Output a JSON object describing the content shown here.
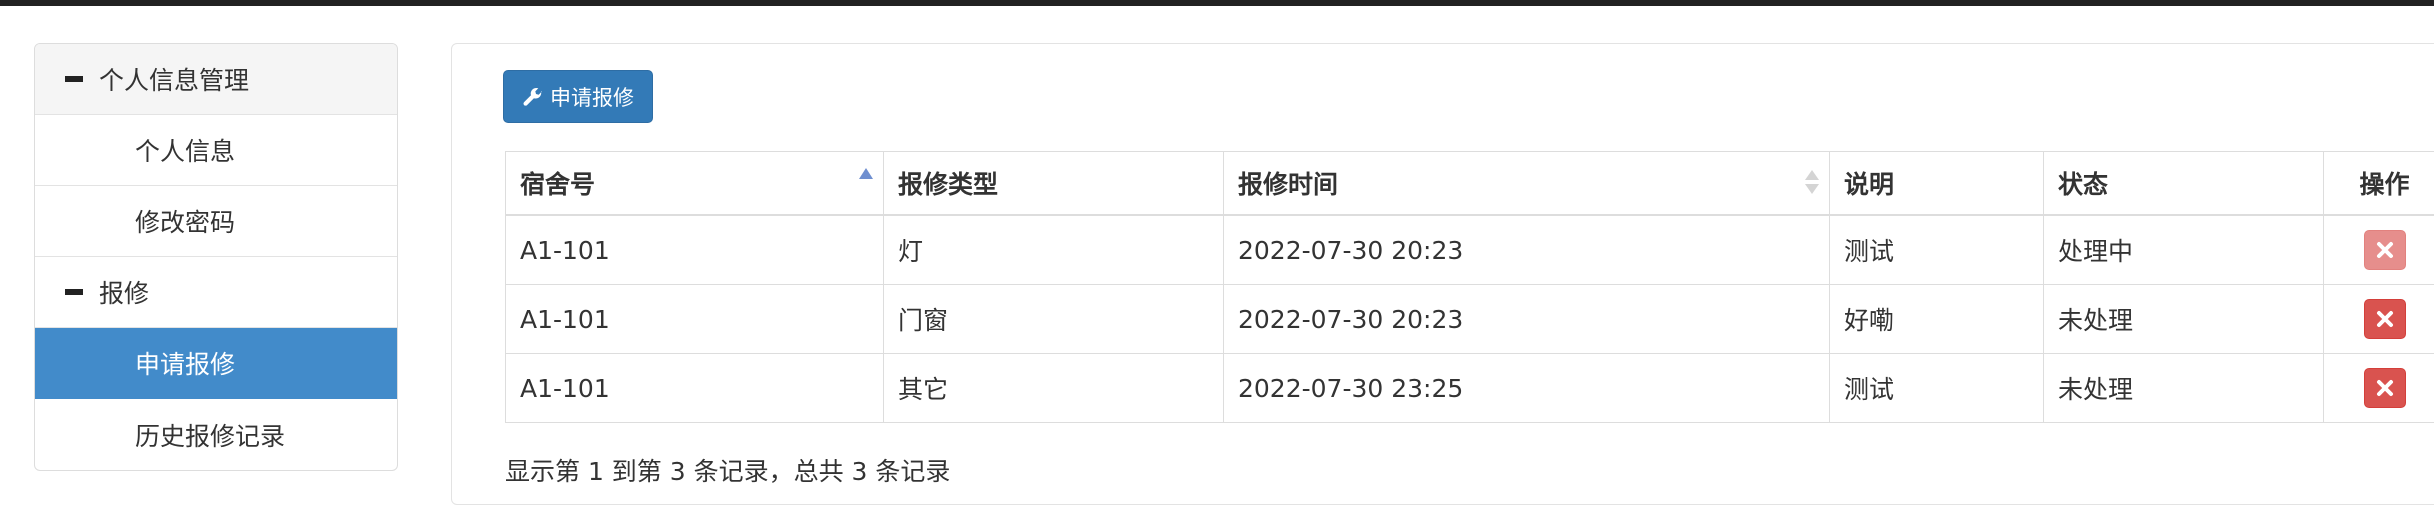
{
  "sidebar": {
    "groups": [
      {
        "label": "个人信息管理",
        "items": [
          "个人信息",
          "修改密码"
        ]
      },
      {
        "label": "报修",
        "items": [
          "申请报修",
          "历史报修记录"
        ]
      }
    ],
    "active_item": "申请报修"
  },
  "toolbar": {
    "apply_label": "申请报修",
    "apply_icon": "wrench-icon"
  },
  "table": {
    "columns": [
      "宿舍号",
      "报修类型",
      "报修时间",
      "说明",
      "状态",
      "操作"
    ],
    "sorted_column": "宿舍号",
    "sort_direction": "ascending",
    "rows": [
      {
        "room": "A1-101",
        "type": "灯",
        "time": "2022-07-30 20:23",
        "note": "测试",
        "status": "处理中",
        "action_icon": "close-icon",
        "action_enabled": false
      },
      {
        "room": "A1-101",
        "type": "门窗",
        "time": "2022-07-30 20:23",
        "note": "好嘞",
        "status": "未处理",
        "action_icon": "close-icon",
        "action_enabled": true
      },
      {
        "room": "A1-101",
        "type": "其它",
        "time": "2022-07-30 23:25",
        "note": "测试",
        "status": "未处理",
        "action_icon": "close-icon",
        "action_enabled": true
      }
    ]
  },
  "pagination": {
    "info": "显示第 1 到第 3 条记录，总共 3 条记录"
  },
  "colors": {
    "primary": "#337ab7",
    "active_nav": "#428bca",
    "danger": "#d9534f"
  }
}
